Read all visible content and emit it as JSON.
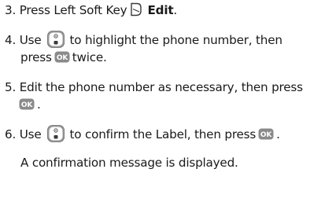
{
  "steps": [
    {
      "number": "3.",
      "text_before": "Press Left Soft Key",
      "bold_label": "Edit",
      "text_after": "."
    },
    {
      "number": "4.",
      "text_before": "Use",
      "text_middle": "to highlight the phone number, then",
      "text_line2_before": "press",
      "text_line2_after": "twice."
    },
    {
      "number": "5.",
      "text_line1": "Edit the phone number as necessary, then press",
      "text_line2_after": "."
    },
    {
      "number": "6.",
      "text_before": "Use",
      "text_middle": "to confirm the Label, then press",
      "text_after": "."
    }
  ],
  "note": "A confirmation message is displayed.",
  "icons": {
    "softkey": "left-soft-key-icon",
    "nav": "navigation-key-icon",
    "ok": "ok-key-icon"
  },
  "ok_label": "OK",
  "colors": {
    "text": "#1a1a1a",
    "icon_gray": "#8a8a8a",
    "icon_dark": "#3a3a3a"
  }
}
